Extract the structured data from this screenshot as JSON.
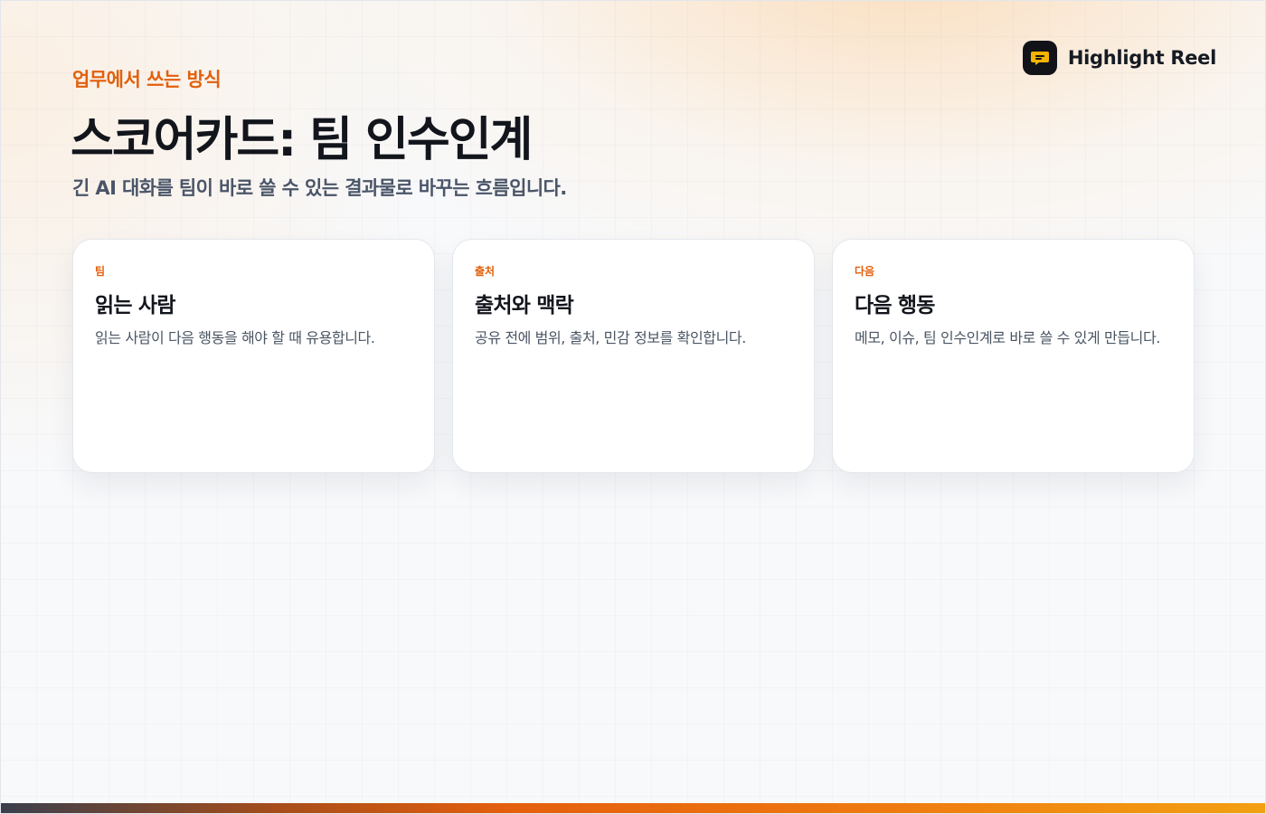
{
  "brand": {
    "name": "Highlight Reel",
    "icon": "speech-bubble-icon",
    "logo_color": "#111318",
    "accent": "#f5b301"
  },
  "header": {
    "eyebrow": "업무에서 쓰는 방식",
    "title": "스코어카드: 팀 인수인계",
    "subtitle": "긴 AI 대화를 팀이 바로 쓸 수 있는 결과물로 바꾸는 흐름입니다."
  },
  "cards": [
    {
      "tag": "팀",
      "title": "읽는 사람",
      "body": "읽는 사람이 다음 행동을 해야 할 때 유용합니다."
    },
    {
      "tag": "출처",
      "title": "출처와 맥락",
      "body": "공유 전에 범위, 출처, 민감 정보를 확인합니다."
    },
    {
      "tag": "다음",
      "title": "다음 행동",
      "body": "메모, 이슈, 팀 인수인계로 바로 쓸 수 있게 만듭니다."
    }
  ],
  "colors": {
    "accent": "#e2600c",
    "text_primary": "#12151c",
    "text_secondary": "#4a5568"
  }
}
